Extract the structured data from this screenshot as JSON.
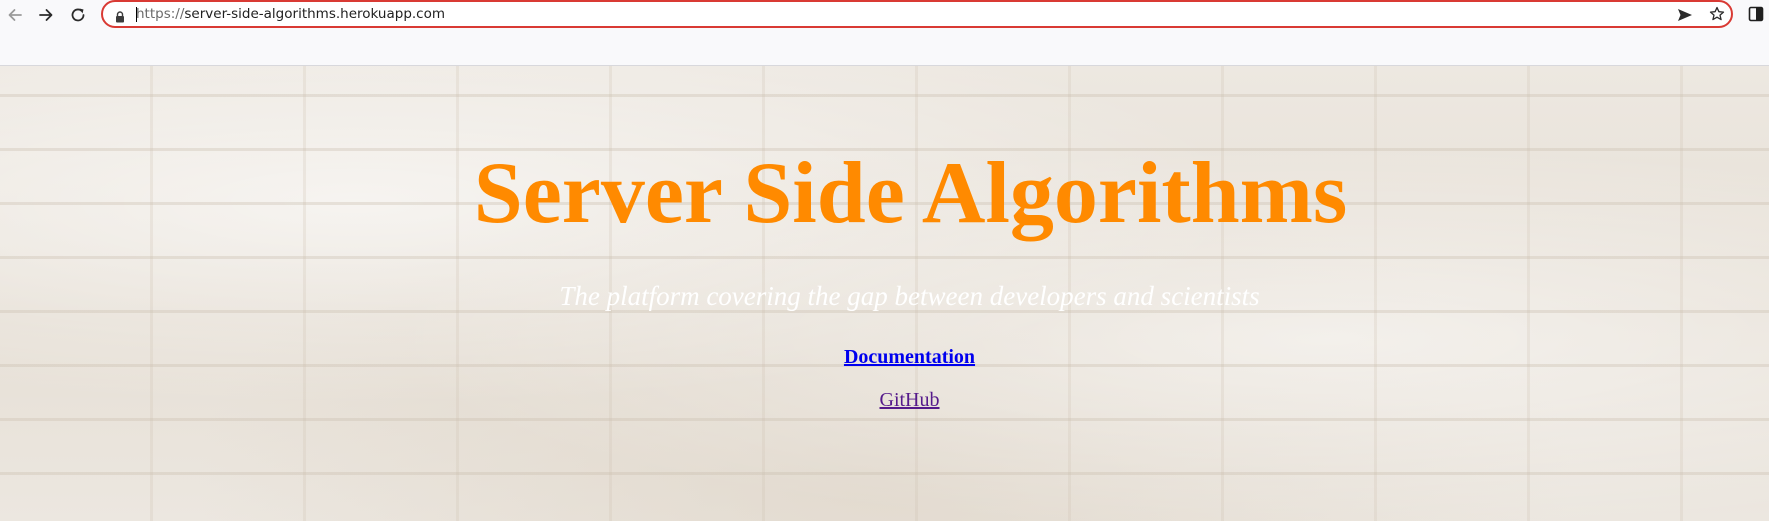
{
  "browser": {
    "url_scheme": "https://",
    "url_rest": "server-side-algorithms.herokuapp.com",
    "icons": {
      "back": "arrow-left-icon",
      "forward": "arrow-right-icon",
      "reload": "reload-icon",
      "lock": "lock-icon",
      "send": "send-icon",
      "bookmark": "star-icon",
      "panel": "side-panel-icon"
    },
    "colors": {
      "address_border": "#d93a34"
    }
  },
  "page": {
    "title": "Server Side Algorithms",
    "tagline": "The platform covering the gap between developers and scientists",
    "links": {
      "documentation": "Documentation",
      "github": "GitHub"
    },
    "colors": {
      "title": "#ff8a00",
      "tagline": "#ffffff",
      "link": "#0000ee",
      "visited_link": "#551a8b"
    }
  }
}
